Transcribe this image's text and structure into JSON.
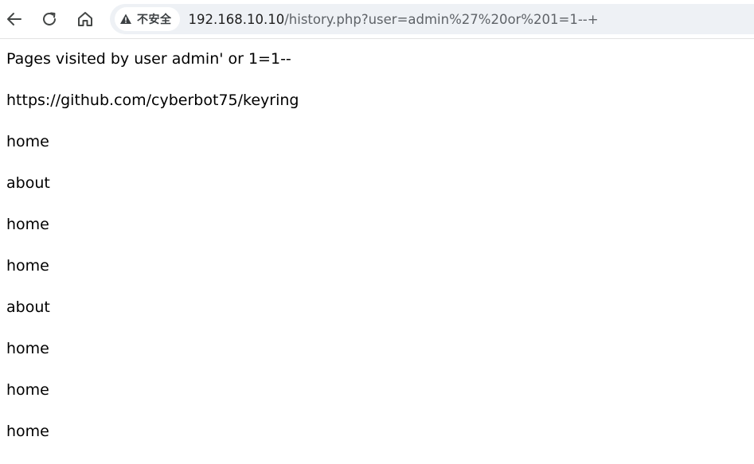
{
  "browser": {
    "security_label": "不安全",
    "url_host": "192.168.10.10",
    "url_path": "/history.php?user=admin%27%20or%201=1--+",
    "icons": [
      "back-arrow-icon",
      "reload-icon",
      "home-icon",
      "warning-triangle-icon"
    ]
  },
  "page": {
    "heading": "Pages visited by user admin' or 1=1--",
    "entries": [
      "https://github.com/cyberbot75/keyring",
      "home",
      "about",
      "home",
      "home",
      "about",
      "home",
      "home",
      "home"
    ]
  }
}
